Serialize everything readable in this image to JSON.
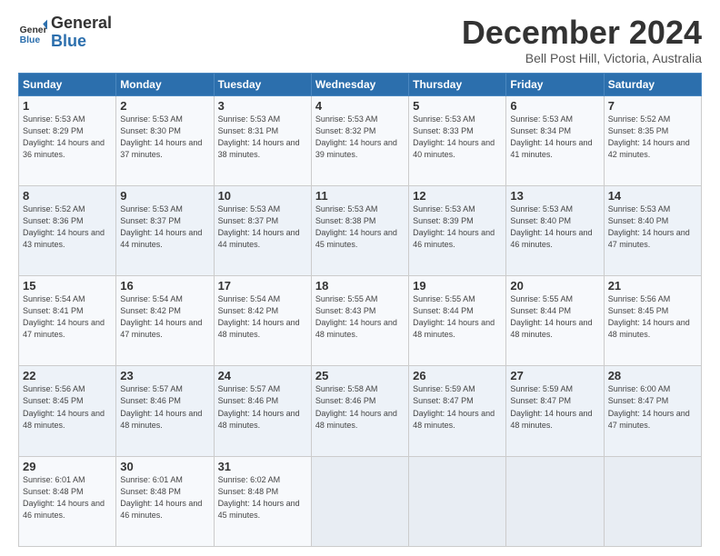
{
  "logo": {
    "line1": "General",
    "line2": "Blue"
  },
  "title": "December 2024",
  "subtitle": "Bell Post Hill, Victoria, Australia",
  "header_days": [
    "Sunday",
    "Monday",
    "Tuesday",
    "Wednesday",
    "Thursday",
    "Friday",
    "Saturday"
  ],
  "weeks": [
    [
      {
        "day": 1,
        "sunrise": "5:53 AM",
        "sunset": "8:29 PM",
        "daylight": "14 hours and 36 minutes."
      },
      {
        "day": 2,
        "sunrise": "5:53 AM",
        "sunset": "8:30 PM",
        "daylight": "14 hours and 37 minutes."
      },
      {
        "day": 3,
        "sunrise": "5:53 AM",
        "sunset": "8:31 PM",
        "daylight": "14 hours and 38 minutes."
      },
      {
        "day": 4,
        "sunrise": "5:53 AM",
        "sunset": "8:32 PM",
        "daylight": "14 hours and 39 minutes."
      },
      {
        "day": 5,
        "sunrise": "5:53 AM",
        "sunset": "8:33 PM",
        "daylight": "14 hours and 40 minutes."
      },
      {
        "day": 6,
        "sunrise": "5:53 AM",
        "sunset": "8:34 PM",
        "daylight": "14 hours and 41 minutes."
      },
      {
        "day": 7,
        "sunrise": "5:52 AM",
        "sunset": "8:35 PM",
        "daylight": "14 hours and 42 minutes."
      }
    ],
    [
      {
        "day": 8,
        "sunrise": "5:52 AM",
        "sunset": "8:36 PM",
        "daylight": "14 hours and 43 minutes."
      },
      {
        "day": 9,
        "sunrise": "5:53 AM",
        "sunset": "8:37 PM",
        "daylight": "14 hours and 44 minutes."
      },
      {
        "day": 10,
        "sunrise": "5:53 AM",
        "sunset": "8:37 PM",
        "daylight": "14 hours and 44 minutes."
      },
      {
        "day": 11,
        "sunrise": "5:53 AM",
        "sunset": "8:38 PM",
        "daylight": "14 hours and 45 minutes."
      },
      {
        "day": 12,
        "sunrise": "5:53 AM",
        "sunset": "8:39 PM",
        "daylight": "14 hours and 46 minutes."
      },
      {
        "day": 13,
        "sunrise": "5:53 AM",
        "sunset": "8:40 PM",
        "daylight": "14 hours and 46 minutes."
      },
      {
        "day": 14,
        "sunrise": "5:53 AM",
        "sunset": "8:40 PM",
        "daylight": "14 hours and 47 minutes."
      }
    ],
    [
      {
        "day": 15,
        "sunrise": "5:54 AM",
        "sunset": "8:41 PM",
        "daylight": "14 hours and 47 minutes."
      },
      {
        "day": 16,
        "sunrise": "5:54 AM",
        "sunset": "8:42 PM",
        "daylight": "14 hours and 47 minutes."
      },
      {
        "day": 17,
        "sunrise": "5:54 AM",
        "sunset": "8:42 PM",
        "daylight": "14 hours and 48 minutes."
      },
      {
        "day": 18,
        "sunrise": "5:55 AM",
        "sunset": "8:43 PM",
        "daylight": "14 hours and 48 minutes."
      },
      {
        "day": 19,
        "sunrise": "5:55 AM",
        "sunset": "8:44 PM",
        "daylight": "14 hours and 48 minutes."
      },
      {
        "day": 20,
        "sunrise": "5:55 AM",
        "sunset": "8:44 PM",
        "daylight": "14 hours and 48 minutes."
      },
      {
        "day": 21,
        "sunrise": "5:56 AM",
        "sunset": "8:45 PM",
        "daylight": "14 hours and 48 minutes."
      }
    ],
    [
      {
        "day": 22,
        "sunrise": "5:56 AM",
        "sunset": "8:45 PM",
        "daylight": "14 hours and 48 minutes."
      },
      {
        "day": 23,
        "sunrise": "5:57 AM",
        "sunset": "8:46 PM",
        "daylight": "14 hours and 48 minutes."
      },
      {
        "day": 24,
        "sunrise": "5:57 AM",
        "sunset": "8:46 PM",
        "daylight": "14 hours and 48 minutes."
      },
      {
        "day": 25,
        "sunrise": "5:58 AM",
        "sunset": "8:46 PM",
        "daylight": "14 hours and 48 minutes."
      },
      {
        "day": 26,
        "sunrise": "5:59 AM",
        "sunset": "8:47 PM",
        "daylight": "14 hours and 48 minutes."
      },
      {
        "day": 27,
        "sunrise": "5:59 AM",
        "sunset": "8:47 PM",
        "daylight": "14 hours and 48 minutes."
      },
      {
        "day": 28,
        "sunrise": "6:00 AM",
        "sunset": "8:47 PM",
        "daylight": "14 hours and 47 minutes."
      }
    ],
    [
      {
        "day": 29,
        "sunrise": "6:01 AM",
        "sunset": "8:48 PM",
        "daylight": "14 hours and 46 minutes."
      },
      {
        "day": 30,
        "sunrise": "6:01 AM",
        "sunset": "8:48 PM",
        "daylight": "14 hours and 46 minutes."
      },
      {
        "day": 31,
        "sunrise": "6:02 AM",
        "sunset": "8:48 PM",
        "daylight": "14 hours and 45 minutes."
      },
      null,
      null,
      null,
      null
    ]
  ]
}
